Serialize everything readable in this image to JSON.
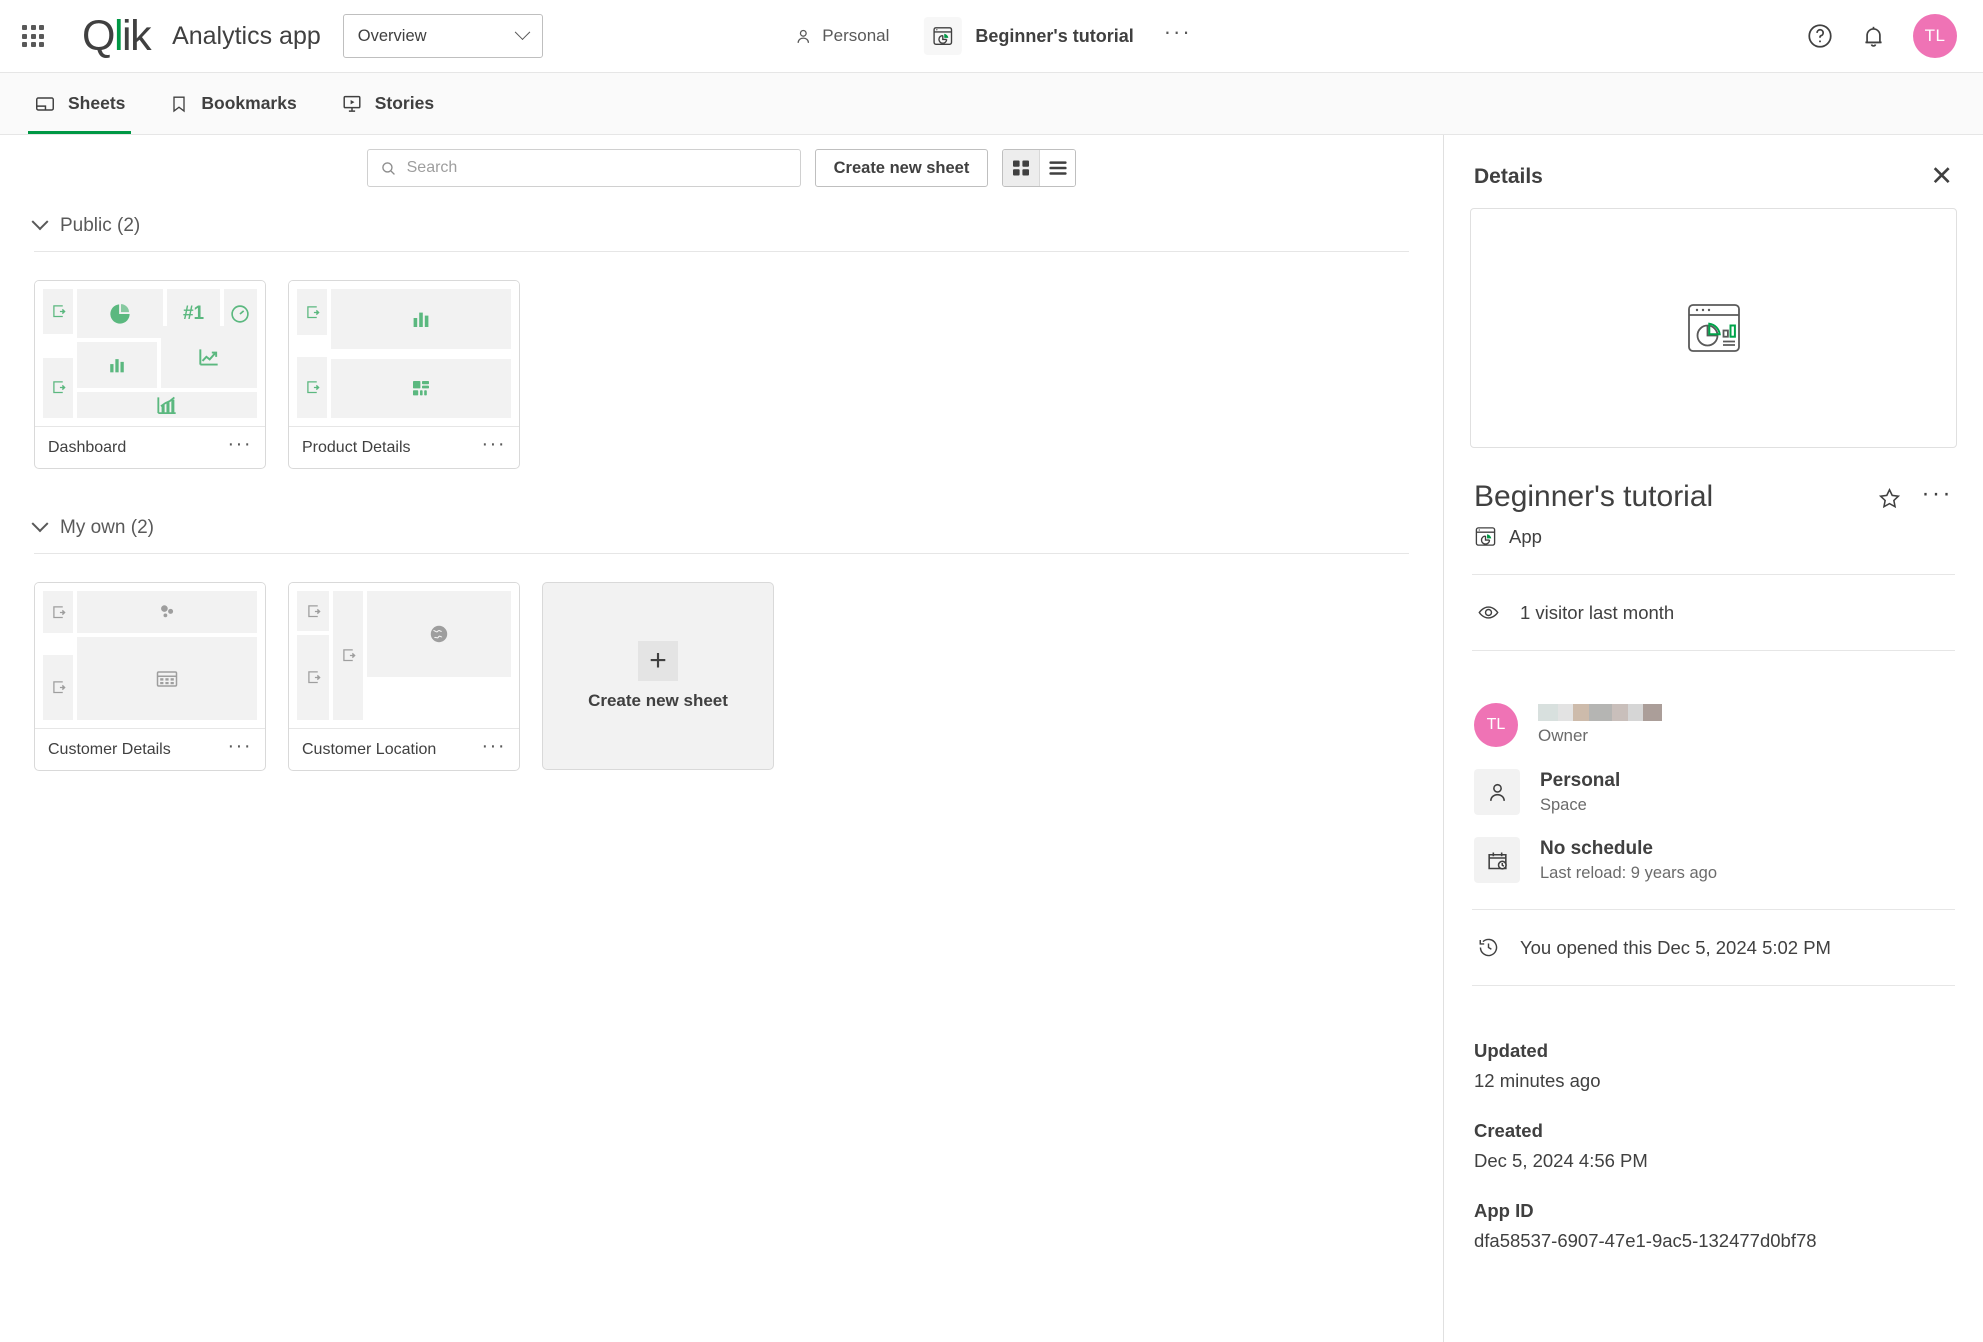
{
  "header": {
    "waffle_icon": "grid-apps-icon",
    "logo_text": "Qlik",
    "app_kind": "Analytics app",
    "view_selector": {
      "value": "Overview",
      "options": [
        "Overview"
      ]
    },
    "breadcrumb": {
      "space": "Personal",
      "app_name": "Beginner's tutorial",
      "more_label": "···"
    },
    "help_icon": "help-circle-icon",
    "notifications_icon": "bell-icon",
    "avatar_initials": "TL",
    "avatar_color": "#ef73b5"
  },
  "nav": {
    "tabs": [
      {
        "label": "Sheets",
        "icon": "sheet-icon",
        "active": true
      },
      {
        "label": "Bookmarks",
        "icon": "bookmark-icon",
        "active": false
      },
      {
        "label": "Stories",
        "icon": "story-icon",
        "active": false
      }
    ],
    "accent_color": "#009845"
  },
  "toolbar": {
    "search_placeholder": "Search",
    "search_value": "",
    "search_icon": "search-icon",
    "create_sheet_label": "Create new sheet",
    "view_grid_icon": "grid-view-icon",
    "view_list_icon": "list-view-icon",
    "active_view": "grid"
  },
  "sections": [
    {
      "title": "Public (2)",
      "expanded": true,
      "sheets": [
        {
          "name": "Dashboard",
          "menu": "···",
          "icon_color": "#5bb87f"
        },
        {
          "name": "Product Details",
          "menu": "···",
          "icon_color": "#5bb87f"
        }
      ]
    },
    {
      "title": "My own (2)",
      "expanded": true,
      "sheets": [
        {
          "name": "Customer Details",
          "menu": "···",
          "icon_color": "#9e9e9e"
        },
        {
          "name": "Customer Location",
          "menu": "···",
          "icon_color": "#9e9e9e"
        }
      ],
      "create_card": {
        "label": "Create new sheet",
        "plus": "+"
      }
    }
  ],
  "details": {
    "panel_title": "Details",
    "close_icon": "close-icon",
    "preview_icon": "app-chart-window-icon",
    "app_title": "Beginner's tutorial",
    "favorite_icon": "star-outline-icon",
    "more_icon": "ellipsis-icon",
    "type_icon": "app-icon",
    "type_label": "App",
    "visitors_icon": "eye-icon",
    "visitors_text": "1 visitor last month",
    "owner": {
      "avatar_initials": "TL",
      "name_redacted": true,
      "role_label": "Owner"
    },
    "space": {
      "icon": "person-icon",
      "name": "Personal",
      "label": "Space"
    },
    "schedule": {
      "icon": "calendar-clock-icon",
      "name": "No schedule",
      "label": "Last reload: 9 years ago"
    },
    "opened": {
      "icon": "history-clock-icon",
      "text": "You opened this Dec 5, 2024 5:02 PM"
    },
    "fields": [
      {
        "key": "Updated",
        "value": "12 minutes ago"
      },
      {
        "key": "Created",
        "value": "Dec 5, 2024 4:56 PM"
      },
      {
        "key": "App ID",
        "value": "dfa58537-6907-47e1-9ac5-132477d0bf78"
      }
    ]
  }
}
